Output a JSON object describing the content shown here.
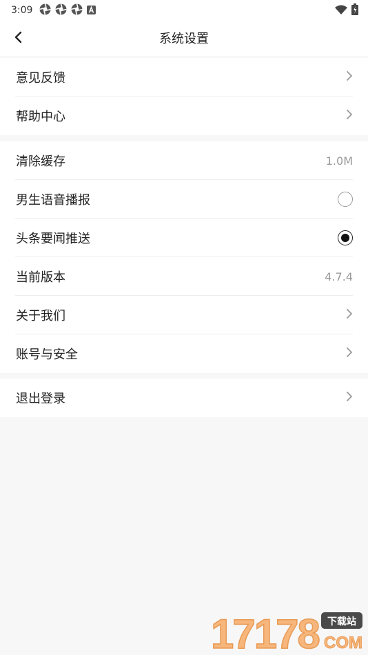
{
  "status_bar": {
    "time": "3:09",
    "notification_icons": [
      "aperture-icon",
      "aperture-icon",
      "aperture-icon",
      "a-badge-icon"
    ],
    "right_icons": [
      "wifi-icon",
      "battery-icon"
    ]
  },
  "header": {
    "title": "系统设置",
    "back_icon": "chevron-left-icon"
  },
  "groups": [
    {
      "items": [
        {
          "label": "意见反馈",
          "accessory": "chevron"
        },
        {
          "label": "帮助中心",
          "accessory": "chevron"
        }
      ]
    },
    {
      "items": [
        {
          "label": "清除缓存",
          "accessory": "value",
          "value": "1.0M"
        },
        {
          "label": "男生语音播报",
          "accessory": "radio",
          "checked": false
        },
        {
          "label": "头条要闻推送",
          "accessory": "radio",
          "checked": true
        },
        {
          "label": "当前版本",
          "accessory": "value",
          "value": "4.7.4"
        },
        {
          "label": "关于我们",
          "accessory": "chevron"
        },
        {
          "label": "账号与安全",
          "accessory": "chevron"
        }
      ]
    },
    {
      "items": [
        {
          "label": "退出登录",
          "accessory": "chevron"
        }
      ]
    }
  ],
  "watermark": {
    "numbers": "17178",
    "badge": "下载站",
    "domain": "COM"
  },
  "colors": {
    "page_background": "#f7f7f7",
    "row_background": "#ffffff",
    "divider": "#eeeeee",
    "secondary_text": "#999999",
    "chevron": "#9a9a9a",
    "watermark_orange": "#f7b77c"
  }
}
